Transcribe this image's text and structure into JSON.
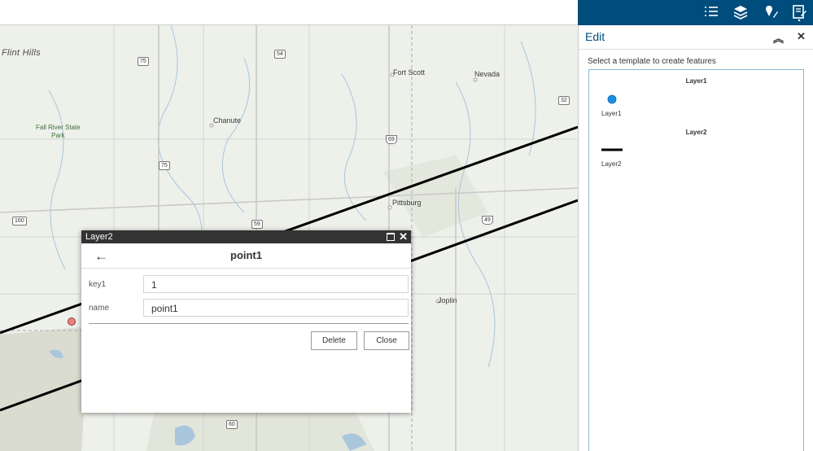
{
  "map": {
    "labels": {
      "flint_hills": "Flint Hills",
      "fall_river": "Fall River State",
      "park": "Park",
      "chanute": "Chanute",
      "fort_scott": "Fort Scott",
      "nevada": "Nevada",
      "pittsburg": "Pittsburg",
      "joplin": "Joplin"
    },
    "shields": {
      "r75a": "75",
      "r54": "54",
      "r32": "32",
      "r69": "69",
      "r75b": "75",
      "r160": "160",
      "r59": "59",
      "r49": "49",
      "r60": "60"
    }
  },
  "popup": {
    "layer_title": "Layer2",
    "feature_name": "point1",
    "fields": [
      {
        "label": "key1",
        "value": "1"
      },
      {
        "label": "name",
        "value": "point1"
      }
    ],
    "delete_label": "Delete",
    "close_label": "Close"
  },
  "panel": {
    "title": "Edit",
    "caption": "Select a template to create features",
    "groups": [
      {
        "header": "Layer1",
        "template_label": "Layer1",
        "symbol_color": "#1a8fe0"
      },
      {
        "header": "Layer2",
        "template_label": "Layer2",
        "symbol_color": "#000000"
      }
    ]
  },
  "colors": {
    "header_bg": "#004c7c",
    "popup_title_bg": "#333333",
    "point_fill": "#f08080"
  }
}
